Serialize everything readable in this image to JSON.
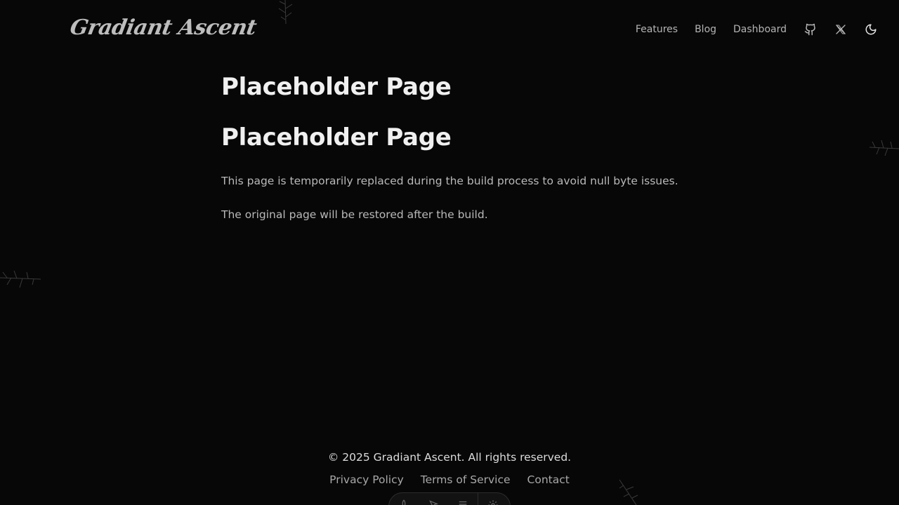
{
  "header": {
    "logo_text": "Gradiant Ascent",
    "nav": {
      "features": "Features",
      "blog": "Blog",
      "dashboard": "Dashboard"
    },
    "icons": [
      "github-icon",
      "x-twitter-icon",
      "moon-icon"
    ]
  },
  "main": {
    "title_1": "Placeholder Page",
    "title_2": "Placeholder Page",
    "paragraph_1": "This page is temporarily replaced during the build process to avoid null byte issues.",
    "paragraph_2": "The original page will be restored after the build."
  },
  "footer": {
    "copyright": "© 2025 Gradiant Ascent. All rights reserved.",
    "links": {
      "privacy": "Privacy Policy",
      "terms": "Terms of Service",
      "contact": "Contact"
    }
  },
  "dev_toolbar": {
    "icons": [
      "rocket-icon",
      "cursor-icon",
      "menu-icon",
      "gear-icon"
    ]
  },
  "colors": {
    "background": "#070707",
    "heading": "#f0f0f0",
    "body_text": "#b9b9b9",
    "nav_text": "#b4b4b4"
  }
}
